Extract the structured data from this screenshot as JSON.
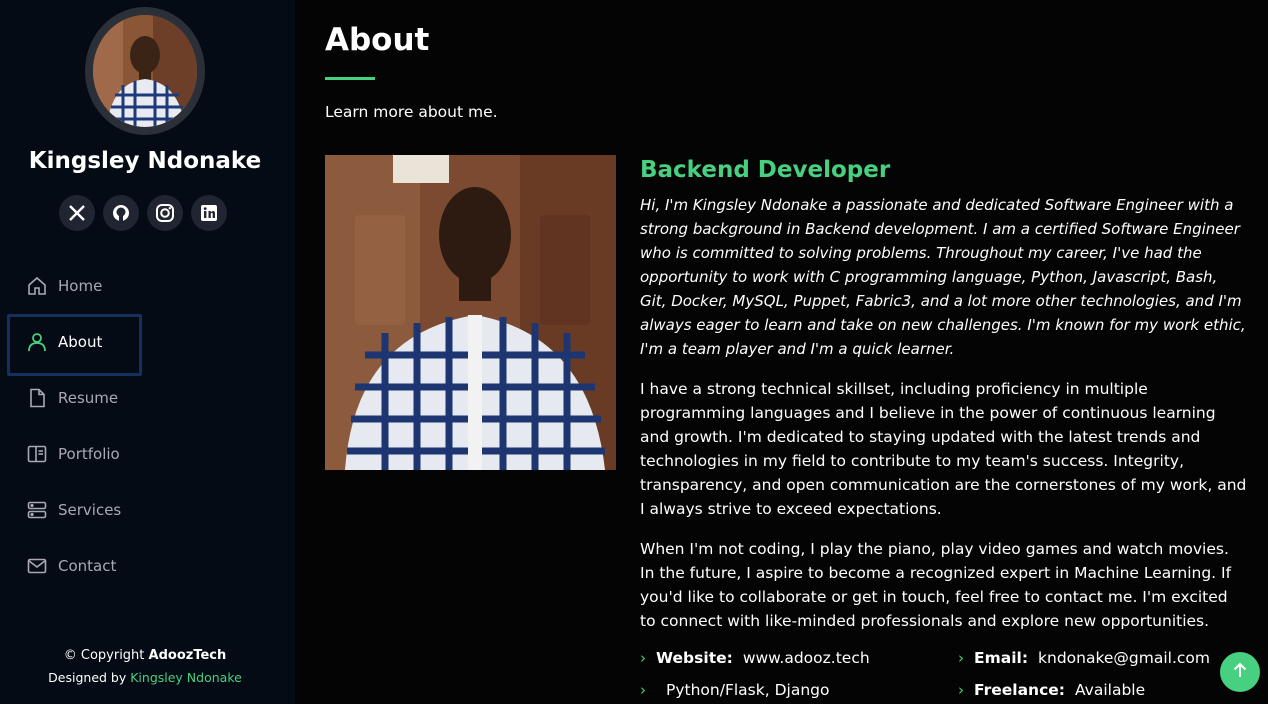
{
  "sidebar": {
    "name": "Kingsley Ndonake",
    "socials": [
      {
        "icon": "x-twitter-icon",
        "glyph": "𝕏"
      },
      {
        "icon": "github-icon",
        "glyph": ""
      },
      {
        "icon": "instagram-icon",
        "glyph": ""
      },
      {
        "icon": "linkedin-icon",
        "glyph": ""
      }
    ],
    "nav": [
      {
        "label": "Home",
        "icon": "home-icon"
      },
      {
        "label": "About",
        "icon": "person-icon",
        "active": true
      },
      {
        "label": "Resume",
        "icon": "document-icon"
      },
      {
        "label": "Portfolio",
        "icon": "portfolio-icon"
      },
      {
        "label": "Services",
        "icon": "server-icon"
      },
      {
        "label": "Contact",
        "icon": "envelope-icon"
      }
    ],
    "footer": {
      "copyright_prefix": "© Copyright ",
      "copyright_brand": "AdoozTech",
      "designed_prefix": "Designed by ",
      "designed_by": "Kingsley Ndonake"
    }
  },
  "main": {
    "title": "About",
    "subtitle": "Learn more about me.",
    "role": "Backend Developer",
    "intro": "Hi, I'm Kingsley Ndonake a passionate and dedicated Software Engineer with a strong background in Backend development. I am a certified Software Engineer who is committed to solving problems. Throughout my career, I've had the opportunity to work with C programming language, Python, Javascript, Bash, Git, Docker, MySQL, Puppet, Fabric3, and a lot more other technologies, and I'm always eager to learn and take on new challenges. I'm known for my work ethic, I'm a team player and I'm a quick learner.",
    "paragraphs": [
      "I have a strong technical skillset, including proficiency in multiple programming languages and I believe in the power of continuous learning and growth. I'm dedicated to staying updated with the latest trends and technologies in my field to contribute to my team's success. Integrity, transparency, and open communication are the cornerstones of my work, and I always strive to exceed expectations.",
      "When I'm not coding, I play the piano, play video games and watch movies. In the future, I aspire to become a recognized expert in Machine Learning. If you'd like to collaborate or get in touch, feel free to contact me. I'm excited to connect with like-minded professionals and explore new opportunities."
    ],
    "info": [
      {
        "label": "Website:",
        "value": "www.adooz.tech"
      },
      {
        "label": "Email:",
        "value": "kndonake@gmail.com"
      },
      {
        "label": "",
        "value": "Python/Flask, Django"
      },
      {
        "label": "Freelance:",
        "value": "Available"
      }
    ]
  },
  "colors": {
    "accent": "#47d080",
    "sidebar_bg": "#040b14",
    "active_border": "#14305c"
  }
}
